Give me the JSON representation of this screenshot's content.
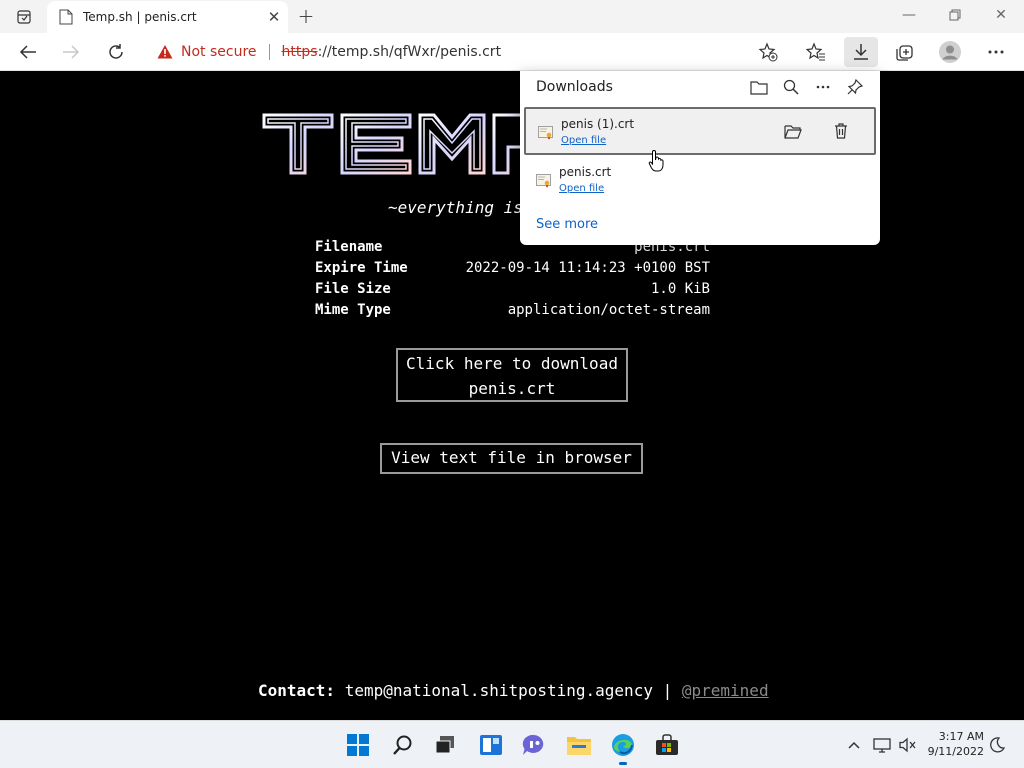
{
  "browser": {
    "tab": {
      "title": "Temp.sh | penis.crt"
    },
    "address": {
      "security_label": "Not secure",
      "url_scheme": "https",
      "url_rest": "://temp.sh/qfWxr/penis.crt"
    }
  },
  "page": {
    "logo_text": "TEMP",
    "tagline": "~everything is",
    "info": [
      {
        "key": "Filename",
        "value": "penis.crt"
      },
      {
        "key": "Expire Time",
        "value": "2022-09-14 11:14:23 +0100 BST"
      },
      {
        "key": "File Size",
        "value": "1.0 KiB"
      },
      {
        "key": "Mime Type",
        "value": "application/octet-stream"
      }
    ],
    "download_button": {
      "line1": "Click here to download",
      "line2": "penis.crt"
    },
    "view_button": "View text file in browser",
    "footer": {
      "contact_label": "Contact:",
      "email": "temp@national.shitposting.agency",
      "separator": "|",
      "handle": "@premined"
    }
  },
  "downloads": {
    "title": "Downloads",
    "items": [
      {
        "name": "penis (1).crt",
        "action": "Open file"
      },
      {
        "name": "penis.crt",
        "action": "Open file"
      }
    ],
    "see_more": "See more"
  },
  "taskbar": {
    "time": "3:17 AM",
    "date": "9/11/2022"
  },
  "colors": {
    "page_bg": "#000000",
    "not_secure": "#c42b1c",
    "link": "#0f62c8",
    "accent": "#0067c0"
  }
}
